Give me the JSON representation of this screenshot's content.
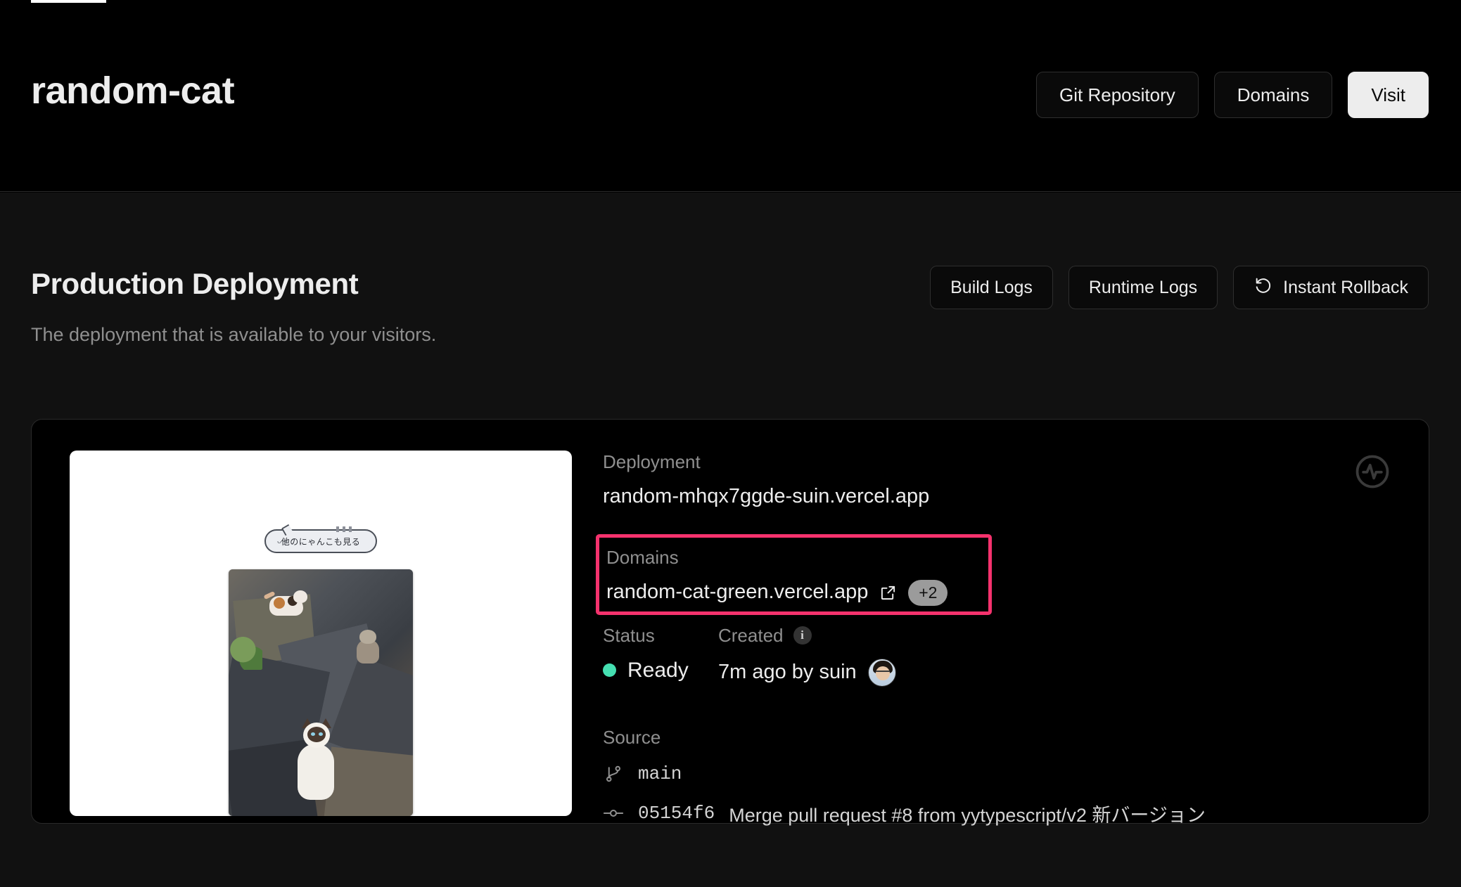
{
  "header": {
    "project_title": "random-cat",
    "buttons": [
      {
        "label": "Git Repository",
        "name": "git-repository-button"
      },
      {
        "label": "Domains",
        "name": "domains-button"
      },
      {
        "label": "Visit",
        "name": "visit-button"
      }
    ]
  },
  "section": {
    "title": "Production Deployment",
    "subtitle": "The deployment that is available to your visitors.",
    "buttons": [
      {
        "label": "Build Logs"
      },
      {
        "label": "Runtime Logs"
      },
      {
        "label": "Instant Rollback"
      }
    ]
  },
  "preview": {
    "cat_button_label": "他のにゃんこも見る",
    "cat_button_face": "ᴗ·̫ᴗ"
  },
  "deployment": {
    "deployment_label": "Deployment",
    "deployment_value": "random-mhqx7ggde-suin.vercel.app",
    "domains_label": "Domains",
    "domains_value": "random-cat-green.vercel.app",
    "domains_extra_badge": "+2",
    "status_label": "Status",
    "status_value": "Ready",
    "created_label": "Created",
    "created_value": "7m ago by suin",
    "source_label": "Source",
    "branch": "main",
    "commit_hash": "05154f6",
    "commit_message": "Merge pull request #8 from yytypescript/v2 新バージョン"
  },
  "colors": {
    "page_bg": "#111111",
    "header_bg": "#000000",
    "card_bg": "#000000",
    "accent_highlight": "#f5326d",
    "status_ready": "#45dfb1",
    "text_primary": "#ededed",
    "text_muted": "#8f8f8f",
    "badge_bg": "#9b9b9b"
  }
}
